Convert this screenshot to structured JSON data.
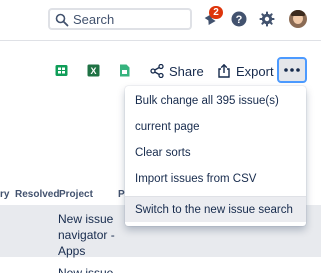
{
  "header": {
    "search_placeholder": "Search",
    "notification_count": "2",
    "icons": [
      "search-icon",
      "notification-bell-icon",
      "help-icon",
      "settings-gear-icon",
      "user-avatar"
    ]
  },
  "toolbar": {
    "share_label": "Share",
    "export_label": "Export",
    "icons": [
      "google-sheets-icon",
      "excel-icon",
      "csv-icon",
      "share-icon",
      "export-icon",
      "more-options-icon"
    ]
  },
  "dropdown": {
    "items": [
      "Bulk change all 395 issue(s)",
      "current page",
      "Clear sorts",
      "Import issues from CSV",
      "Switch to the new issue search"
    ]
  },
  "table": {
    "columns": [
      "ry",
      "Resolved",
      "Project",
      "P"
    ],
    "rows": [
      {
        "project": "New issue navigator - Apps"
      },
      {
        "project": "New issue"
      }
    ]
  },
  "colors": {
    "accent_focus": "#4c9aff",
    "badge_red": "#de350b",
    "row_highlight": "#e8eaee",
    "text": "#172b4d"
  }
}
